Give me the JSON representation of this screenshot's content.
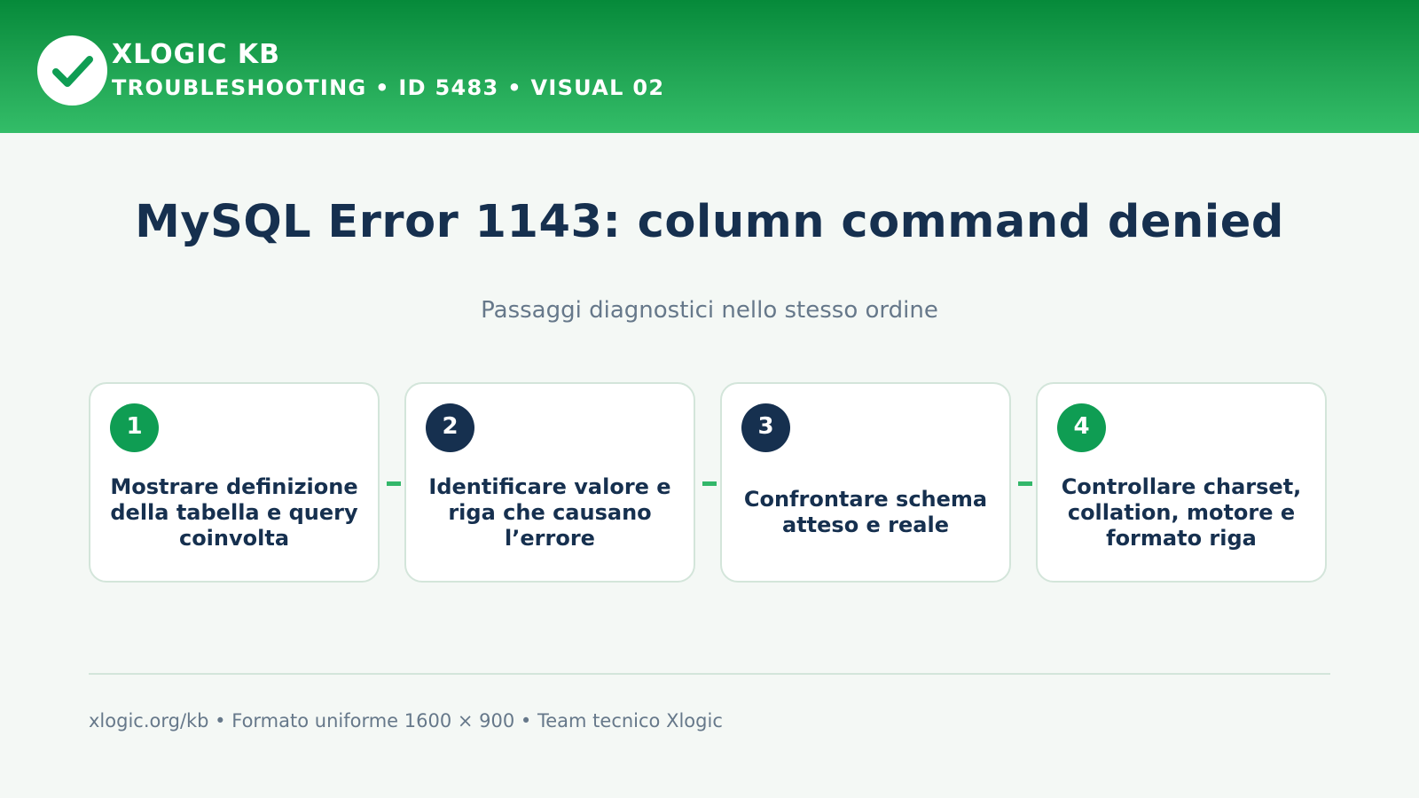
{
  "brand": {
    "logo_icon": "checkmark-icon",
    "title": "XLOGIC KB",
    "subtitle": "TROUBLESHOOTING • ID 5483 • VISUAL 02"
  },
  "main": {
    "title": "MySQL Error 1143: column command denied",
    "subtitle": "Passaggi diagnostici nello stesso ordine"
  },
  "steps": [
    {
      "number": "1",
      "text": "Mostrare definizione della tabella e query coinvolta"
    },
    {
      "number": "2",
      "text": "Identificare valore e riga che causano l’errore"
    },
    {
      "number": "3",
      "text": "Confrontare schema atteso e reale"
    },
    {
      "number": "4",
      "text": "Controllare charset, collation, motore e formato riga"
    }
  ],
  "footer": {
    "text": "xlogic.org/kb • Formato uniforme 1600 × 900 • Team tecnico Xlogic"
  },
  "colors": {
    "header_green": "#1fa352",
    "accent_green": "#0f9d53",
    "navy": "#16304f",
    "background": "#f4f8f5",
    "card_border": "#d3e5da",
    "muted_text": "#66788a"
  }
}
